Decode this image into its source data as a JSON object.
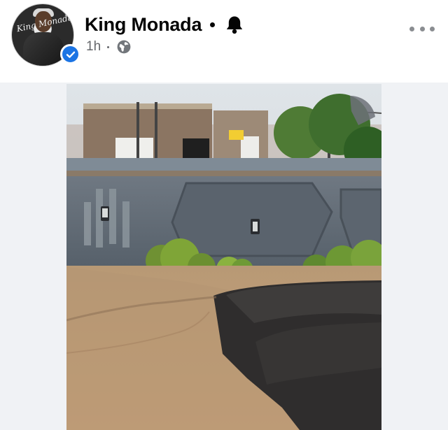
{
  "post": {
    "author": "King Monada",
    "author_avatar_text": "King Monada",
    "verified": true,
    "time": "1h",
    "audience": "globe-icon",
    "notifications": "bell-icon",
    "more": "more-options-icon"
  },
  "photo": {
    "sign_color": "#f2cd32",
    "wall_color": "#616a74",
    "accent": "#1b74e4"
  }
}
